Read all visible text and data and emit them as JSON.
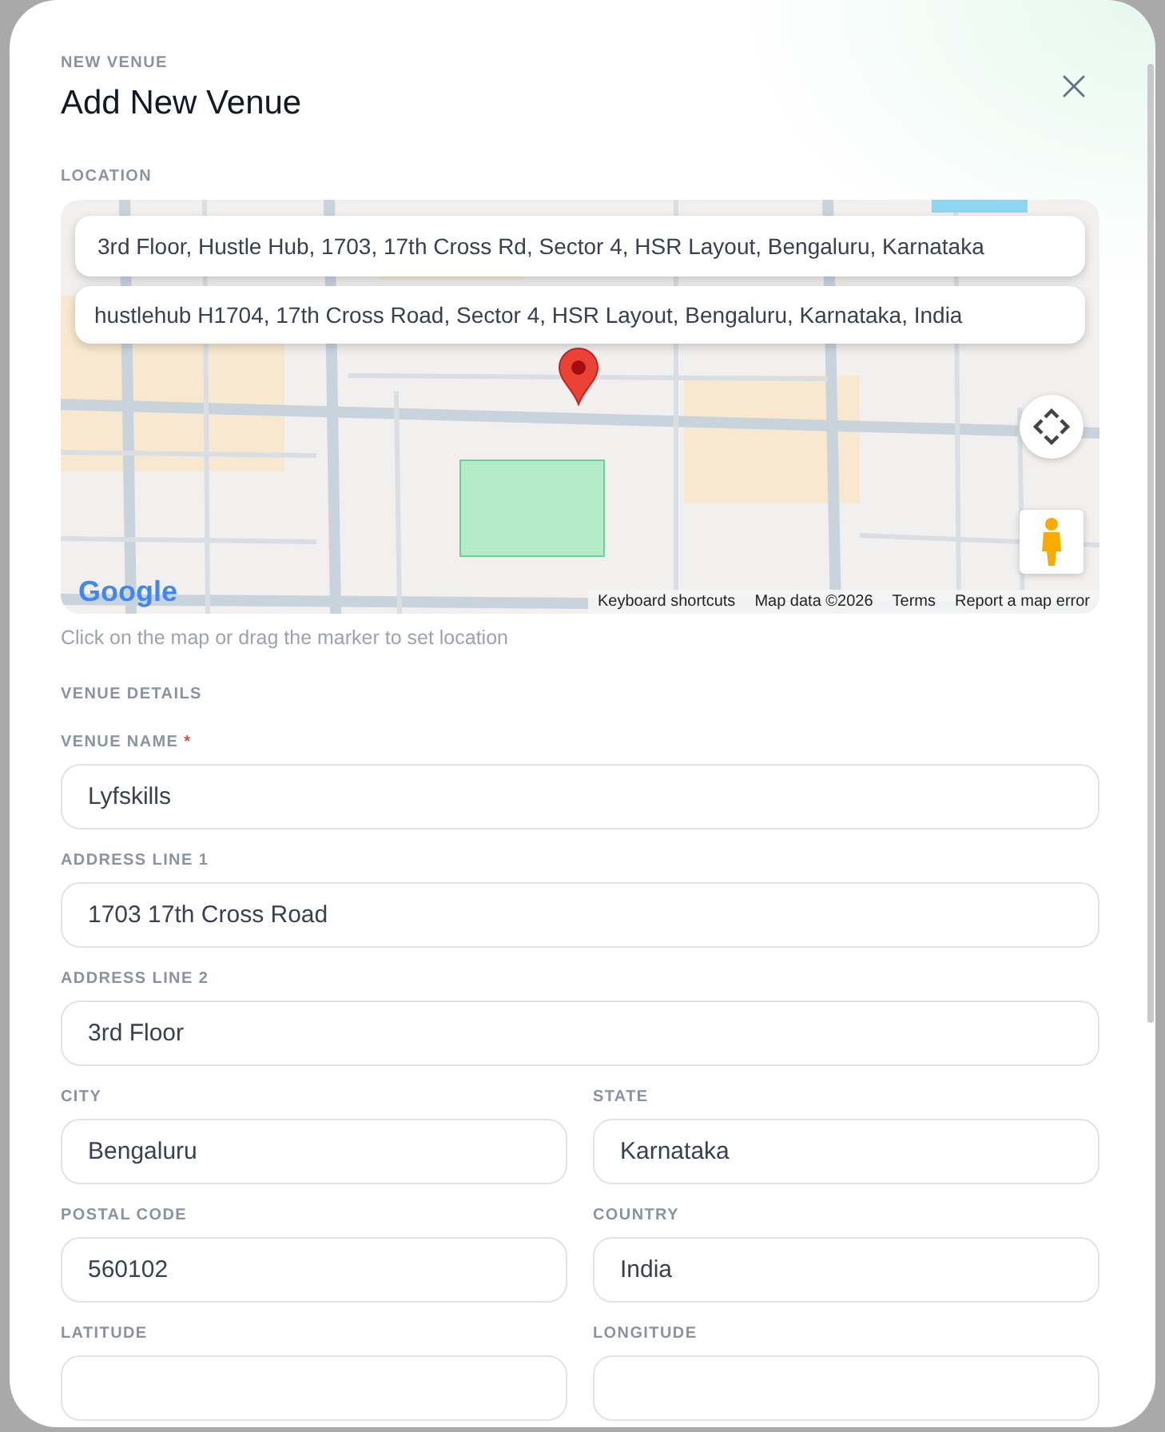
{
  "header": {
    "eyebrow": "NEW VENUE",
    "title": "Add New Venue"
  },
  "location": {
    "label": "LOCATION",
    "suggestions": [
      {
        "text": "3rd Floor, Hustle Hub, 1703, 17th Cross Rd, Sector 4, HSR Layout, Bengaluru, Karnataka"
      },
      {
        "text": "hustlehub H1704, 17th Cross Road, Sector 4, HSR Layout, Bengaluru, Karnataka, India"
      }
    ],
    "map_logo": "Google",
    "map_footer": [
      "Keyboard shortcuts",
      "Map data ©2026",
      "Terms",
      "Report a map error"
    ],
    "hint": "Click on the map or drag the marker to set location"
  },
  "details": {
    "label": "VENUE DETAILS",
    "rows": [
      [
        {
          "label": "VENUE NAME",
          "required_mark": "*",
          "value": "Lyfskills"
        }
      ],
      [
        {
          "label": "ADDRESS LINE 1",
          "value": "1703 17th Cross Road"
        }
      ],
      [
        {
          "label": "ADDRESS LINE 2",
          "value": "3rd Floor"
        }
      ],
      [
        {
          "label": "CITY",
          "value": "Bengaluru"
        },
        {
          "label": "STATE",
          "value": "Karnataka"
        }
      ],
      [
        {
          "label": "POSTAL CODE",
          "value": "560102"
        },
        {
          "label": "COUNTRY",
          "value": "India"
        }
      ],
      [
        {
          "label": "LATITUDE"
        },
        {
          "label": "LONGITUDE"
        }
      ]
    ]
  }
}
